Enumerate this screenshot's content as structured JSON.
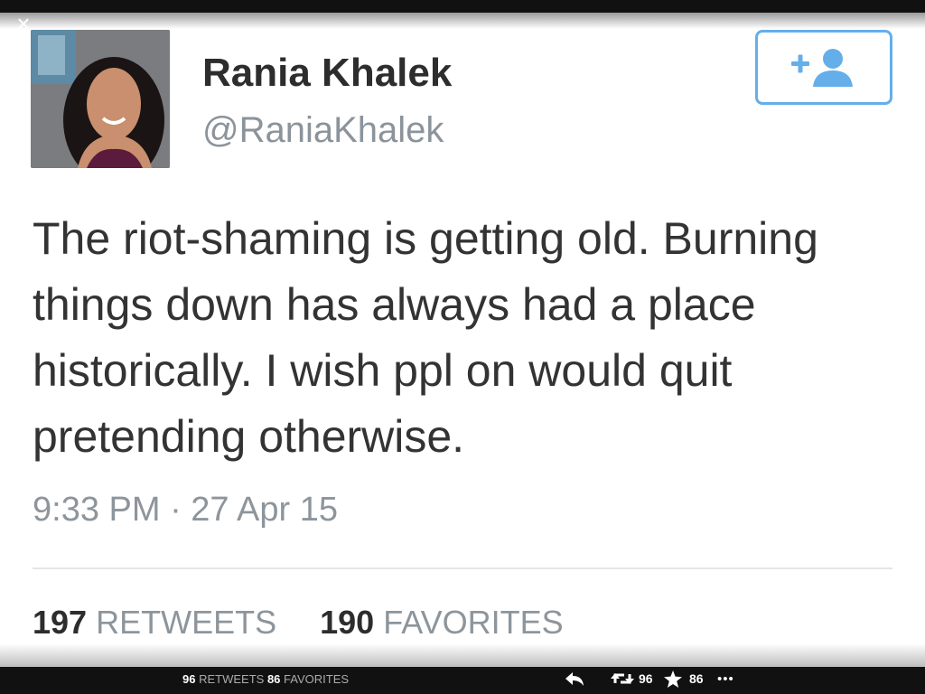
{
  "overlay": {
    "close_glyph": "×"
  },
  "profile": {
    "name": "Rania Khalek",
    "handle": "@RaniaKhalek"
  },
  "follow_button": {
    "icon": "add-user-icon",
    "color": "#64aeea"
  },
  "tweet": {
    "text": "The riot-shaming is getting old. Burning things down has always had a place historically. I wish ppl on would quit pretending otherwise.",
    "timestamp": "9:33 PM · 27 Apr 15"
  },
  "stats": {
    "retweets_count": "197",
    "retweets_label": "RETWEETS",
    "favorites_count": "190",
    "favorites_label": "FAVORITES"
  },
  "footer": {
    "retweets_count": "96",
    "retweets_label": "RETWEETS",
    "favorites_count": "86",
    "favorites_label": "FAVORITES",
    "action_retweet_count": "96",
    "action_favorite_count": "86",
    "more_glyph": "•••"
  }
}
